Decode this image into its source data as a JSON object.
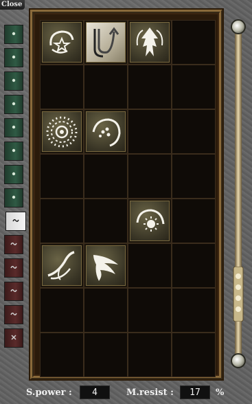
{
  "window": {
    "close_label": "Close"
  },
  "tabs": [
    {
      "color": "green",
      "icon": "dot-icon"
    },
    {
      "color": "green",
      "icon": "dot-icon"
    },
    {
      "color": "green",
      "icon": "dot-icon"
    },
    {
      "color": "green",
      "icon": "dot-icon"
    },
    {
      "color": "green",
      "icon": "dot-icon"
    },
    {
      "color": "green",
      "icon": "dot-icon"
    },
    {
      "color": "green",
      "icon": "dot-icon"
    },
    {
      "color": "green",
      "icon": "dot-icon"
    },
    {
      "color": "active",
      "icon": "wave-icon"
    },
    {
      "color": "red",
      "icon": "wave-icon"
    },
    {
      "color": "red",
      "icon": "wave-icon"
    },
    {
      "color": "red",
      "icon": "wave-icon"
    },
    {
      "color": "red",
      "icon": "wave-icon"
    },
    {
      "color": "red",
      "icon": "cross-icon"
    }
  ],
  "skill_grid": {
    "columns": 4,
    "rows": 8,
    "slots": [
      {
        "row": 0,
        "col": 0,
        "icon": "swirl-star-icon"
      },
      {
        "row": 0,
        "col": 1,
        "icon": "arrow-curl-icon",
        "style": "light"
      },
      {
        "row": 0,
        "col": 2,
        "icon": "arrow-up-flame-icon"
      },
      {
        "row": 2,
        "col": 0,
        "icon": "sun-burst-icon"
      },
      {
        "row": 2,
        "col": 1,
        "icon": "crescent-dots-icon"
      },
      {
        "row": 4,
        "col": 2,
        "icon": "crescent-sun-icon"
      },
      {
        "row": 5,
        "col": 0,
        "icon": "wind-slash-icon"
      },
      {
        "row": 5,
        "col": 1,
        "icon": "wing-icon"
      }
    ]
  },
  "stats": {
    "spower_label": "S.power :",
    "spower_value": "4",
    "mresist_label": "M.resist :",
    "mresist_value": "17",
    "percent_sign": "%"
  }
}
